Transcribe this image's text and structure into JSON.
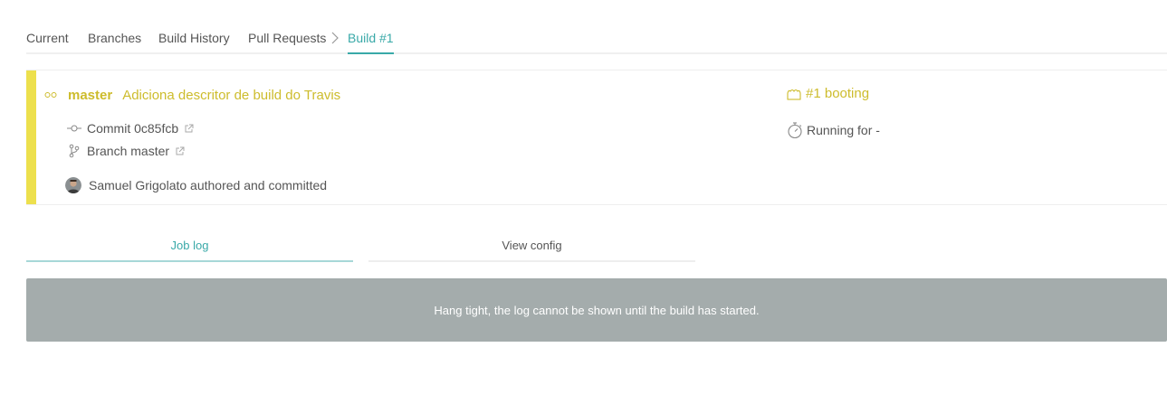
{
  "tabs": [
    {
      "label": "Current"
    },
    {
      "label": "Branches"
    },
    {
      "label": "Build History"
    },
    {
      "label": "Pull Requests"
    },
    {
      "label": "Build #1"
    }
  ],
  "build": {
    "branch": "master",
    "commit_message": "Adiciona descritor de build do Travis",
    "commit_label": "Commit 0c85fcb",
    "branch_label": "Branch master",
    "author_text": "Samuel Grigolato authored and committed",
    "status_text": "#1 booting",
    "running_text": "Running for -",
    "state_color": "#ede04d",
    "text_color": "#cdbc2c"
  },
  "log_tabs": {
    "job_log": "Job log",
    "view_config": "View config"
  },
  "log": {
    "message": "Hang tight, the log cannot be shown until the build has started."
  },
  "colors": {
    "accent": "#39a9a8",
    "log_bg": "#a4acac"
  },
  "icons": [
    "dots-icon",
    "commit-icon",
    "branch-icon",
    "external-link-icon",
    "booting-icon",
    "stopwatch-icon",
    "chevron-right-icon"
  ]
}
